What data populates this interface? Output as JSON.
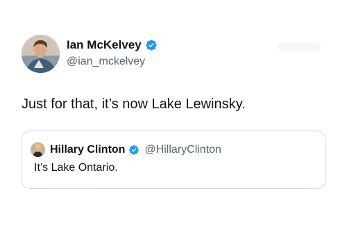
{
  "author": {
    "display_name": "Ian McKelvey",
    "handle": "@ian_mckelvey",
    "avatar_icon": "profile-photo-icon",
    "verified_icon": "verified-badge-icon"
  },
  "tweet": {
    "text": "Just for that, it’s now Lake Lewinsky."
  },
  "quoted_tweet": {
    "display_name": "Hillary Clinton",
    "handle": "@HillaryClinton",
    "text": "It’s Lake Ontario.",
    "avatar_icon": "profile-photo-icon",
    "verified_icon": "verified-badge-icon"
  },
  "colors": {
    "text_primary": "#0f1419",
    "text_secondary": "#536471",
    "verified_blue": "#1d9bf0",
    "card_border": "#d6dbdf"
  }
}
